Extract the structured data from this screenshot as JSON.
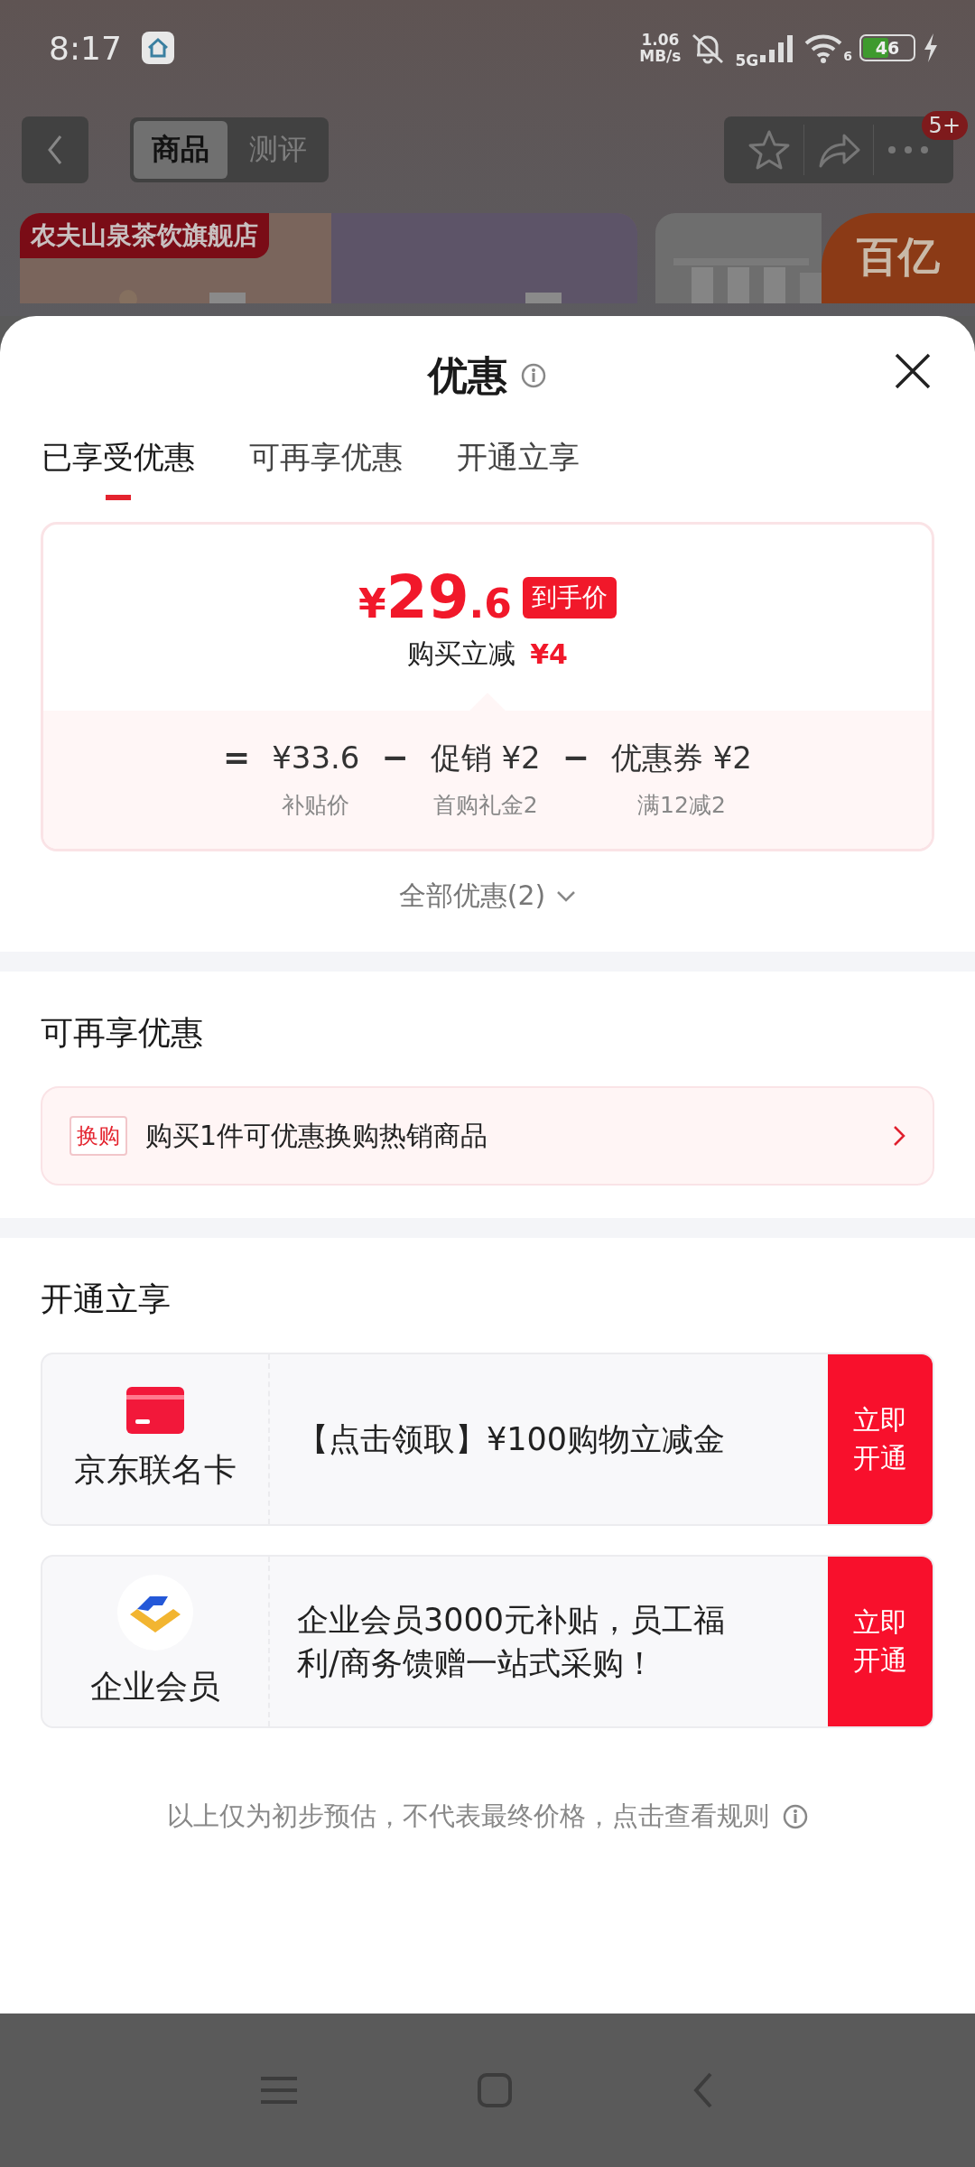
{
  "status_bar": {
    "time": "8:17",
    "net_speed": "1.06",
    "net_unit": "MB/s",
    "network": "5G",
    "wifi_label": "6",
    "battery": "46"
  },
  "top_nav": {
    "segments": [
      {
        "label": "商品",
        "selected": true
      },
      {
        "label": "测评",
        "selected": false
      }
    ],
    "badge": "5+"
  },
  "product": {
    "store_tag": "农夫山泉茶饮旗舰店",
    "promo_badge": "百亿"
  },
  "sheet": {
    "title": "优惠",
    "tabs": [
      {
        "label": "已享受优惠",
        "selected": true
      },
      {
        "label": "可再享优惠",
        "selected": false
      },
      {
        "label": "开通立享",
        "selected": false
      }
    ],
    "price_card": {
      "currency": "¥",
      "price_int": "29",
      "price_dec": ".6",
      "price_tag": "到手价",
      "saving_label": "购买立减",
      "saving": "¥4",
      "breakdown": [
        {
          "op": "=",
          "amount": "¥33.6",
          "note": "补贴价"
        },
        {
          "op": "−",
          "amount": "促销 ¥2",
          "note": "首购礼金2"
        },
        {
          "op": "−",
          "amount": "优惠券 ¥2",
          "note": "满12减2"
        }
      ]
    },
    "all_offers": "全部优惠(2)",
    "more_section": {
      "title": "可再享优惠",
      "offers": [
        {
          "tag": "换购",
          "text": "购买1件可优惠换购热销商品"
        }
      ]
    },
    "open_section": {
      "title": "开通立享",
      "cards": [
        {
          "kind": "card",
          "name": "京东联名卡",
          "text": "【点击领取】¥100购物立减金",
          "button": "立即开通"
        },
        {
          "kind": "member",
          "name": "企业会员",
          "text": "企业会员3000元补贴，员工福利/商务馈赠一站式采购！",
          "button": "立即开通"
        }
      ]
    },
    "note": "以上仅为初步预估，不代表最终价格，点击查看规则"
  }
}
